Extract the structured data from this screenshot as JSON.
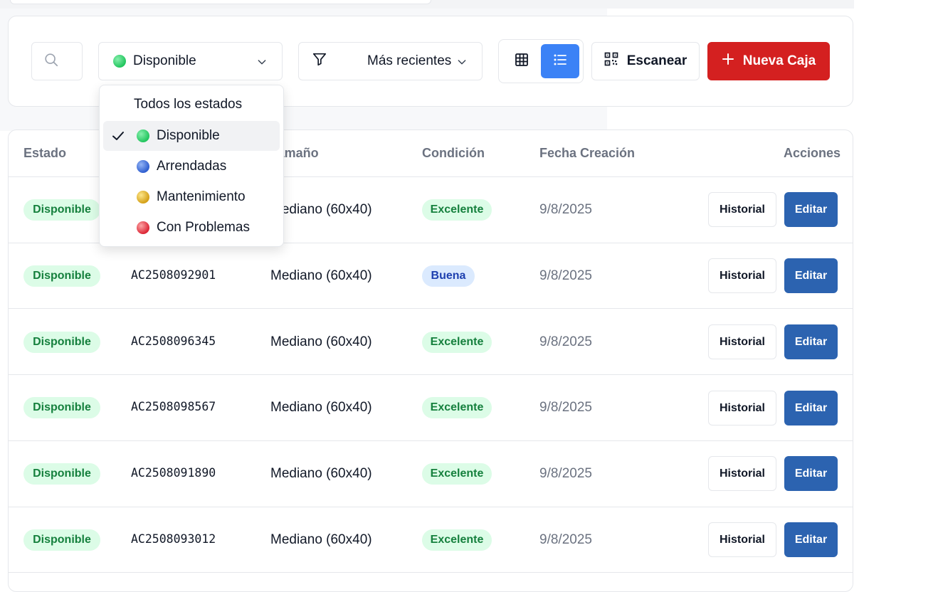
{
  "filters": {
    "search_placeholder": "",
    "status_selected": "Disponible",
    "sort_selected": "Más recientes"
  },
  "actions": {
    "scan_label": "Escanear",
    "new_label": "Nueva Caja"
  },
  "status_dropdown": {
    "all_label": "Todos los estados",
    "options": [
      {
        "label": "Disponible",
        "color": "#22c55e",
        "selected": true
      },
      {
        "label": "Arrendadas",
        "color": "#2f5fd0",
        "selected": false
      },
      {
        "label": "Mantenimiento",
        "color": "#d4a017",
        "selected": false
      },
      {
        "label": "Con Problemas",
        "color": "#dc2636",
        "selected": false
      }
    ]
  },
  "table": {
    "headers": {
      "estado": "Estado",
      "tamano": "Tamaño",
      "condicion": "Condición",
      "fecha": "Fecha Creación",
      "acciones": "Acciones"
    },
    "history_label": "Historial",
    "edit_label": "Editar",
    "rows": [
      {
        "estado": "Disponible",
        "codigo": "",
        "tamano": "Mediano (60x40)",
        "condicion": "Excelente",
        "fecha": "9/8/2025"
      },
      {
        "estado": "Disponible",
        "codigo": "AC2508092901",
        "tamano": "Mediano (60x40)",
        "condicion": "Buena",
        "fecha": "9/8/2025"
      },
      {
        "estado": "Disponible",
        "codigo": "AC2508096345",
        "tamano": "Mediano (60x40)",
        "condicion": "Excelente",
        "fecha": "9/8/2025"
      },
      {
        "estado": "Disponible",
        "codigo": "AC2508098567",
        "tamano": "Mediano (60x40)",
        "condicion": "Excelente",
        "fecha": "9/8/2025"
      },
      {
        "estado": "Disponible",
        "codigo": "AC2508091890",
        "tamano": "Mediano (60x40)",
        "condicion": "Excelente",
        "fecha": "9/8/2025"
      },
      {
        "estado": "Disponible",
        "codigo": "AC2508093012",
        "tamano": "Mediano (60x40)",
        "condicion": "Excelente",
        "fecha": "9/8/2025"
      }
    ]
  },
  "colors": {
    "primary_blue": "#3b82f6",
    "edit_blue": "#2c63b0",
    "new_red": "#d42020",
    "badge_green_bg": "#dcfce7",
    "badge_green_text": "#15803d",
    "badge_blue_bg": "#dbeafe",
    "badge_blue_text": "#1e40af"
  },
  "icons": {
    "search": "search-icon",
    "filter": "filter-icon",
    "chevron": "chevron-down-icon",
    "grid": "grid-view-icon",
    "list": "list-view-icon",
    "qr": "qr-code-icon",
    "plus": "plus-icon",
    "check": "check-icon"
  }
}
